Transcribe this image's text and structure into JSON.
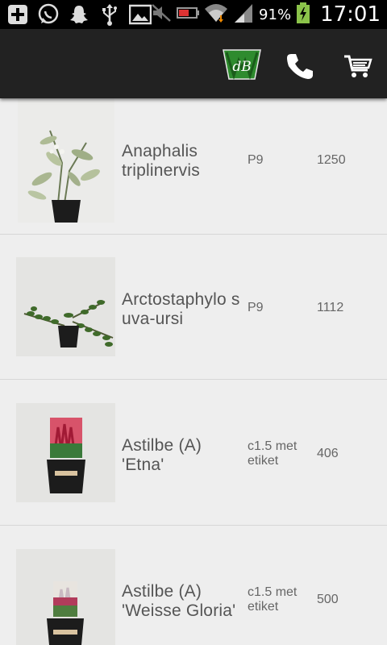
{
  "status_bar": {
    "battery": "91%",
    "time": "17:01",
    "icons_left": [
      "add-icon",
      "whatsapp-icon",
      "snapchat-icon",
      "usb-icon",
      "image-icon"
    ],
    "icons_right": [
      "mute-icon",
      "battery-saver-icon",
      "wifi-icon",
      "signal-icon",
      "battery-icon"
    ]
  },
  "app_bar": {
    "logo_text": "dB",
    "colors": {
      "background": "#222222",
      "logo_green": "#2e8b2e"
    },
    "icons": [
      "phone-icon",
      "cart-icon"
    ]
  },
  "products": [
    {
      "name": "Anaphalis triplinervis",
      "size": "P9",
      "quantity": "1250"
    },
    {
      "name": "Arctostaphylo s uva-ursi",
      "size": "P9",
      "quantity": "1112"
    },
    {
      "name": "Astilbe (A) 'Etna'",
      "size": "c1.5 met etiket",
      "quantity": "406"
    },
    {
      "name": "Astilbe (A) 'Weisse Gloria'",
      "size": "c1.5 met etiket",
      "quantity": "500"
    }
  ]
}
